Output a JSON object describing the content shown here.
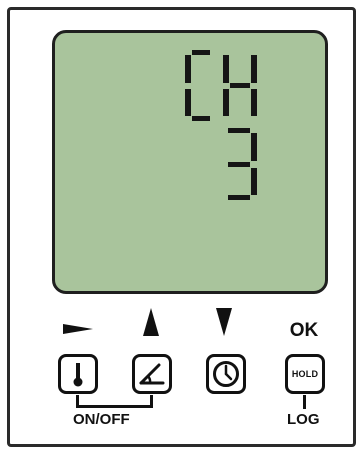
{
  "display": {
    "line1": "CH",
    "line2": "3"
  },
  "colors": {
    "lcd_background": "#a9c49c",
    "segment": "#151515",
    "frame": "#2a2a2a"
  },
  "arrows": {
    "left_icon": "right-triangle-arrow-icon",
    "up_icon": "up-triangle-arrow-icon",
    "down_icon": "down-triangle-arrow-icon",
    "ok_label": "OK"
  },
  "buttons": {
    "thermometer": {
      "icon": "thermometer-icon"
    },
    "angle": {
      "icon": "angle-icon"
    },
    "clock": {
      "icon": "clock-icon"
    },
    "hold": {
      "label": "HOLD"
    }
  },
  "labels": {
    "on_off": "ON/OFF",
    "log": "LOG"
  }
}
